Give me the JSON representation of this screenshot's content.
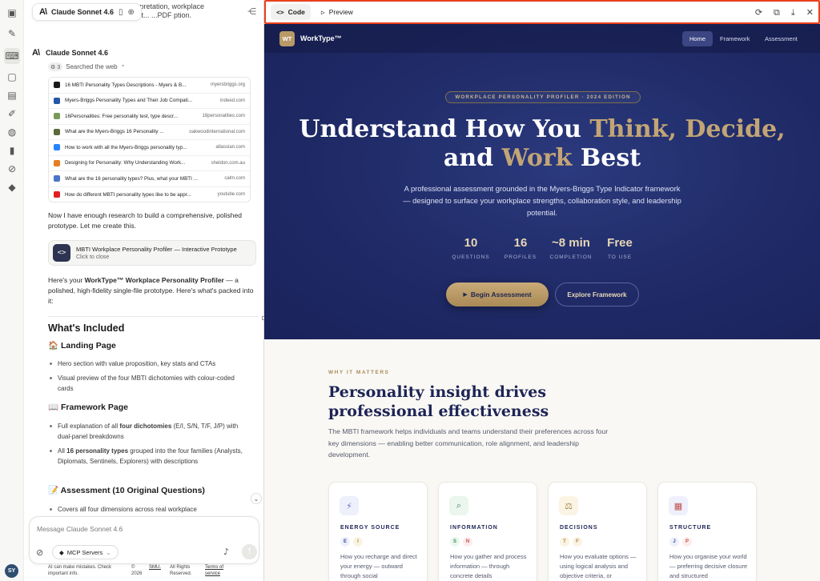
{
  "chat_header": {
    "model_label": "Claude Sonnet 4.6",
    "peek_text_line1": "c... d... rpretation, workplace",
    "peek_text_line2": "...ing... pt... ...PDF ption."
  },
  "message": {
    "sender": "Claude Sonnet 4.6",
    "searched_label": "Searched the web",
    "results": [
      {
        "title": "16 MBTI Personality Types Descriptions - Myers & B...",
        "domain": "myersbriggs.org",
        "color": "#1a1a1a"
      },
      {
        "title": "Myers-Briggs Personality Types and Their Job Compati...",
        "domain": "indeed.com",
        "color": "#2557a7"
      },
      {
        "title": "16Personalities: Free personality test, type descr...",
        "domain": "16personalities.com",
        "color": "#7a9a5a"
      },
      {
        "title": "What are the Myers-Briggs 16 Personality ...",
        "domain": "oakwoodinternational.com",
        "color": "#5a6a3a"
      },
      {
        "title": "How to work with all the Myers-Briggs personality typ...",
        "domain": "atlassian.com",
        "color": "#2684ff"
      },
      {
        "title": "Designing for Personality: Why Understanding Work...",
        "domain": "sheldon.com.au",
        "color": "#e67e22"
      },
      {
        "title": "What are the 16 personality types? Plus, what your MBTI ...",
        "domain": "calm.com",
        "color": "#4a76c9"
      },
      {
        "title": "How do different MBTI personality types like to be appr...",
        "domain": "youtube.com",
        "color": "#e02020"
      }
    ],
    "para1": "Now I have enough research to build a comprehensive, polished prototype. Let me create this.",
    "artifact_title": "MBTI Workplace Personality Profiler — Interactive Prototype",
    "artifact_sub": "Click to close",
    "para2_prefix": "Here's your ",
    "para2_bold": "WorkType™ Workplace Personality Profiler",
    "para2_suffix": " — a polished, high-fidelity single-file prototype. Here's what's packed into it:",
    "whats_included": "What's Included",
    "landing_heading": "🏠 Landing Page",
    "landing_items": [
      "Hero section with value proposition, key stats and CTAs",
      "Visual preview of the four MBTI dichotomies with colour-coded cards"
    ],
    "framework_heading": "📖 Framework Page",
    "framework_item1_a": "Full explanation of all ",
    "framework_item1_b": "four dichotomies",
    "framework_item1_c": " (E/I, S/N, T/F, J/P) with dual-panel breakdowns",
    "framework_item2_a": "All ",
    "framework_item2_b": "16 personality types",
    "framework_item2_c": " grouped into the four families (Analysts, Diplomats, Sentinels, Explorers) with descriptions",
    "assessment_heading": "📝 Assessment (10 Original Questions)",
    "assessment_item": "Covers all four dimensions across real workplace"
  },
  "composer": {
    "placeholder": "Message Claude Sonnet 4.6",
    "mcp_label": "MCP Servers"
  },
  "footer": {
    "disclaimer": "AI can make mistakes. Check important info.",
    "copyright": "© 2026",
    "company": "SMU.",
    "rights": "All Rights Reserved.",
    "terms": "Terms of service"
  },
  "user_initials": "SY",
  "preview_toolbar": {
    "code_tab": "Code",
    "preview_tab": "Preview"
  },
  "site": {
    "logo_mark": "WT",
    "logo_text": "WorkType™",
    "nav": [
      "Home",
      "Framework",
      "Assessment"
    ],
    "badge": "WORKPLACE PERSONALITY PROFILER · 2024 EDITION",
    "h1_a": "Understand How You ",
    "h1_b": "Think, Decide,",
    "h1_c": "and ",
    "h1_d": "Work",
    "h1_e": " Best",
    "subtitle": "A professional assessment grounded in the Myers-Briggs Type Indicator framework — designed to surface your workplace strengths, collaboration style, and leadership potential.",
    "stats": [
      {
        "value": "10",
        "label": "QUESTIONS"
      },
      {
        "value": "16",
        "label": "PROFILES"
      },
      {
        "value": "~8 min",
        "label": "COMPLETION"
      },
      {
        "value": "Free",
        "label": "TO USE"
      }
    ],
    "cta_primary": "Begin Assessment",
    "cta_secondary": "Explore Framework",
    "eyebrow": "WHY IT MATTERS",
    "section_title": "Personality insight drives professional effectiveness",
    "section_body": "The MBTI framework helps individuals and teams understand their preferences across four key dimensions — enabling better communication, role alignment, and leadership development.",
    "cards": [
      {
        "title": "ENERGY SOURCE",
        "letters": [
          "E",
          "I"
        ],
        "desc": "How you recharge and direct your energy — outward through social",
        "icon_bg": "#eef0fb",
        "chip_bg": "#fbf3e2",
        "chip_fg": "#a8864a"
      },
      {
        "title": "INFORMATION",
        "letters": [
          "S",
          "N"
        ],
        "desc": "How you gather and process information — through concrete details",
        "icon_bg": "#eaf6ee",
        "chip_bg": "#fdecec",
        "chip_fg": "#c0504d"
      },
      {
        "title": "DECISIONS",
        "letters": [
          "T",
          "F"
        ],
        "desc": "How you evaluate options — using logical analysis and objective criteria, or",
        "icon_bg": "#fbf4e4",
        "chip_bg": "#fbf3e2",
        "chip_fg": "#a8864a"
      },
      {
        "title": "STRUCTURE",
        "letters": [
          "J",
          "P"
        ],
        "desc": "How you organise your world — preferring decisive closure and structured",
        "icon_bg": "#eef1fb",
        "chip_bg": "#fdecec",
        "chip_fg": "#c0504d"
      }
    ]
  }
}
